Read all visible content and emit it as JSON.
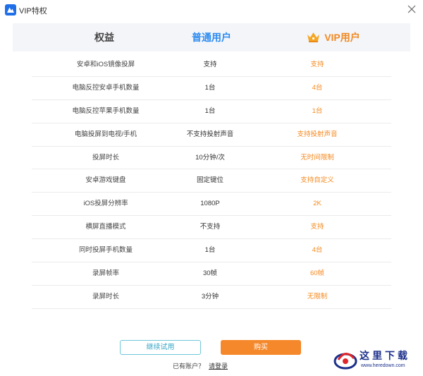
{
  "window": {
    "title": "VIP特权"
  },
  "header": {
    "benefit": "权益",
    "normal": "普通用户",
    "vip": "VIP用户"
  },
  "rows": [
    {
      "benefit": "安卓和iOS镜像投屏",
      "normal": "支持",
      "vip": "支持"
    },
    {
      "benefit": "电脑反控安卓手机数量",
      "normal": "1台",
      "vip": "4台"
    },
    {
      "benefit": "电脑反控苹果手机数量",
      "normal": "1台",
      "vip": "1台"
    },
    {
      "benefit": "电脑投屏到电视/手机",
      "normal": "不支持投射声音",
      "vip": "支持投射声音"
    },
    {
      "benefit": "投屏时长",
      "normal": "10分钟/次",
      "vip": "无时间限制"
    },
    {
      "benefit": "安卓游戏键盘",
      "normal": "固定键位",
      "vip": "支持自定义"
    },
    {
      "benefit": "iOS投屏分辨率",
      "normal": "1080P",
      "vip": "2K"
    },
    {
      "benefit": "横屏直播模式",
      "normal": "不支持",
      "vip": "支持"
    },
    {
      "benefit": "同时投屏手机数量",
      "normal": "1台",
      "vip": "4台"
    },
    {
      "benefit": "录屏帧率",
      "normal": "30帧",
      "vip": "60帧"
    },
    {
      "benefit": "录屏时长",
      "normal": "3分钟",
      "vip": "无限制"
    }
  ],
  "actions": {
    "trial": "继续试用",
    "buy": "购买"
  },
  "login": {
    "prompt": "已有账户？",
    "link": "请登录"
  },
  "watermark": {
    "text": "这里下载",
    "url": "www.heredown.com"
  },
  "colors": {
    "normal": "#2d8cf0",
    "vip": "#f08a24",
    "buy": "#f5882a",
    "trial_border": "#6fc7d8"
  },
  "icons": {
    "app": "app-logo-icon",
    "close": "close-icon",
    "crown": "crown-icon"
  }
}
